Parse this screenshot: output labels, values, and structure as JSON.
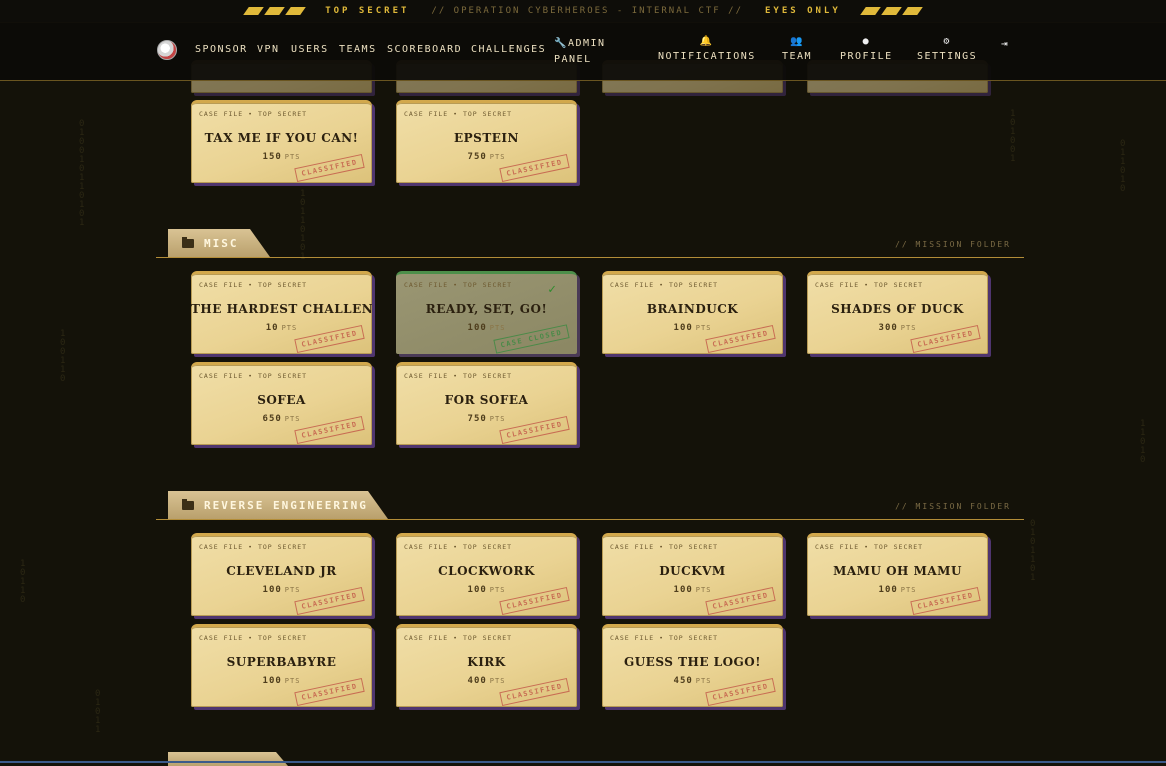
{
  "banner": {
    "left": "TOP SECRET",
    "center": "// OPERATION CYBERHEROES - INTERNAL CTF //",
    "right": "EYES ONLY"
  },
  "nav": {
    "links": [
      "SPONSOR",
      "VPN",
      "USERS",
      "TEAMS",
      "SCOREBOARD",
      "CHALLENGES"
    ],
    "admin_line1": "ADMIN",
    "admin_line2": "PANEL",
    "notifications": "NOTIFICATIONS",
    "team": "TEAM",
    "profile": "PROFILE",
    "settings": "SETTINGS"
  },
  "card_header": "CASE FILE • TOP SECRET",
  "pts_unit": "PTS",
  "stamp_classified": "CLASSIFIED",
  "stamp_closed": "CASE CLOSED",
  "mission_folder": "// MISSION FOLDER",
  "sections": {
    "top_partial": {
      "cards": [
        {
          "title": "TAX ME IF YOU CAN!",
          "points": "150"
        },
        {
          "title": "EPSTEIN",
          "points": "750"
        }
      ]
    },
    "misc": {
      "name": "MISC",
      "cards": [
        {
          "title": "THE HARDEST CHALLENGE.",
          "points": "10"
        },
        {
          "title": "READY, SET, GO!",
          "points": "100",
          "solved": true
        },
        {
          "title": "BRAINDUCK",
          "points": "100"
        },
        {
          "title": "SHADES OF DUCK",
          "points": "300"
        },
        {
          "title": "SOFEA",
          "points": "650"
        },
        {
          "title": "FOR SOFEA",
          "points": "750"
        }
      ]
    },
    "reverse": {
      "name": "REVERSE ENGINEERING",
      "cards": [
        {
          "title": "CLEVELAND JR",
          "points": "100"
        },
        {
          "title": "CLOCKWORK",
          "points": "100"
        },
        {
          "title": "DUCKVM",
          "points": "100"
        },
        {
          "title": "MAMU OH MAMU",
          "points": "100"
        },
        {
          "title": "SUPERBABYRE",
          "points": "100"
        },
        {
          "title": "KIRK",
          "points": "400"
        },
        {
          "title": "GUESS THE LOGO!",
          "points": "450"
        }
      ]
    }
  },
  "colors": {
    "background": "#141209",
    "accent_gold": "#e0b93a",
    "card_paper": "#ead393",
    "card_shadow": "#4f356f",
    "stamp_red": "#c45d4b",
    "solved_green": "#3f8a43"
  }
}
